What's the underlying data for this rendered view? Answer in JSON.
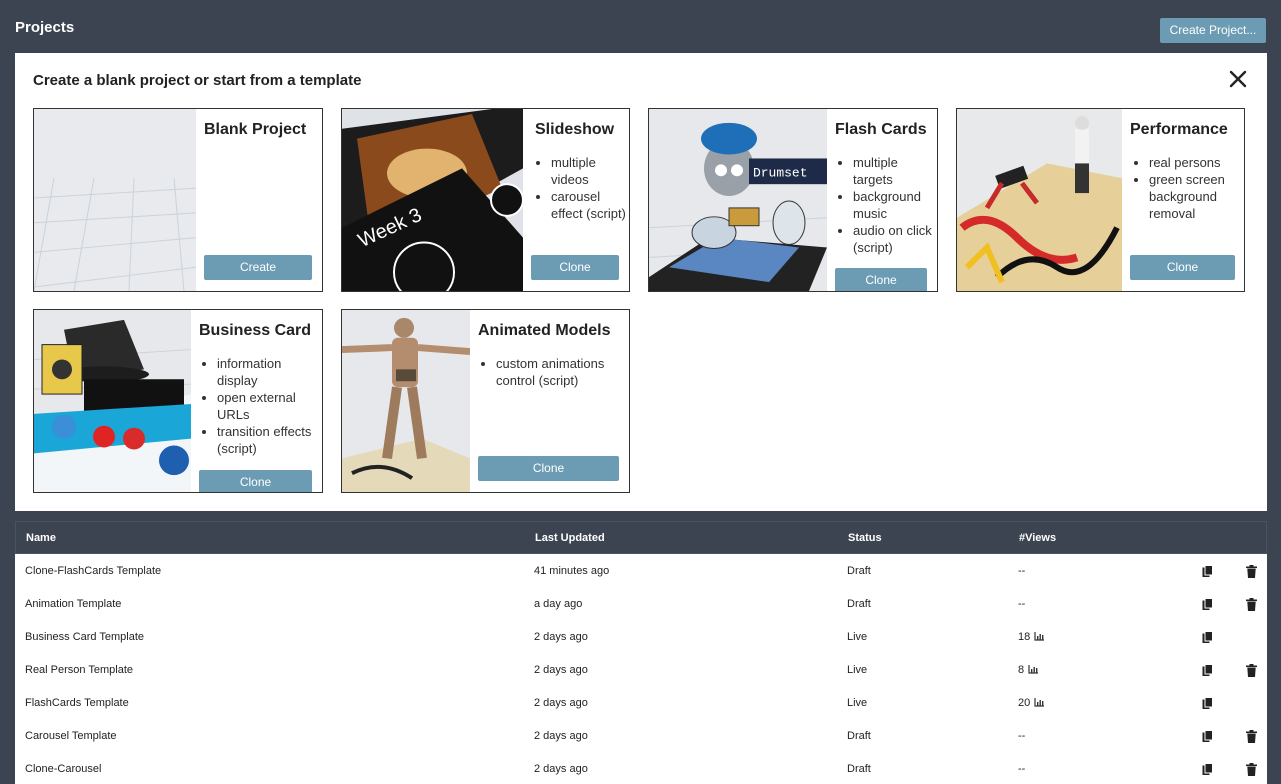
{
  "header": {
    "title": "Projects",
    "create_button": "Create Project..."
  },
  "panel": {
    "title": "Create a blank project or start from a template",
    "cards": [
      {
        "title": "Blank Project",
        "bullets": [],
        "button": "Create"
      },
      {
        "title": "Slideshow",
        "bullets": [
          "multiple videos",
          "carousel effect (script)"
        ],
        "button": "Clone",
        "thumb_text": "Week 3"
      },
      {
        "title": "Flash Cards",
        "bullets": [
          "multiple targets",
          "background music",
          "audio on click (script)"
        ],
        "button": "Clone",
        "thumb_text": "Drumset"
      },
      {
        "title": "Performance",
        "bullets": [
          "real persons",
          "green screen background removal"
        ],
        "button": "Clone"
      },
      {
        "title": "Business Card",
        "bullets": [
          "information display",
          "open external URLs",
          "transition effects (script)"
        ],
        "button": "Clone"
      },
      {
        "title": "Animated Models",
        "bullets": [
          "custom animations control (script)"
        ],
        "button": "Clone"
      }
    ]
  },
  "table": {
    "columns": [
      "Name",
      "Last Updated",
      "Status",
      "#Views"
    ],
    "rows": [
      {
        "name": "Clone-FlashCards Template",
        "updated": "41 minutes ago",
        "status": "Draft",
        "views": "--",
        "deletable": true
      },
      {
        "name": "Animation Template",
        "updated": "a day ago",
        "status": "Draft",
        "views": "--",
        "deletable": true
      },
      {
        "name": "Business Card Template",
        "updated": "2 days ago",
        "status": "Live",
        "views": "18",
        "deletable": false
      },
      {
        "name": "Real Person Template",
        "updated": "2 days ago",
        "status": "Live",
        "views": "8",
        "deletable": true
      },
      {
        "name": "FlashCards Template",
        "updated": "2 days ago",
        "status": "Live",
        "views": "20",
        "deletable": false
      },
      {
        "name": "Carousel Template",
        "updated": "2 days ago",
        "status": "Draft",
        "views": "--",
        "deletable": true
      },
      {
        "name": "Clone-Carousel",
        "updated": "2 days ago",
        "status": "Draft",
        "views": "--",
        "deletable": true
      }
    ]
  },
  "colors": {
    "header_bg": "#3d4451",
    "button": "#6b9cb3",
    "panel_bg": "#ffffff"
  }
}
